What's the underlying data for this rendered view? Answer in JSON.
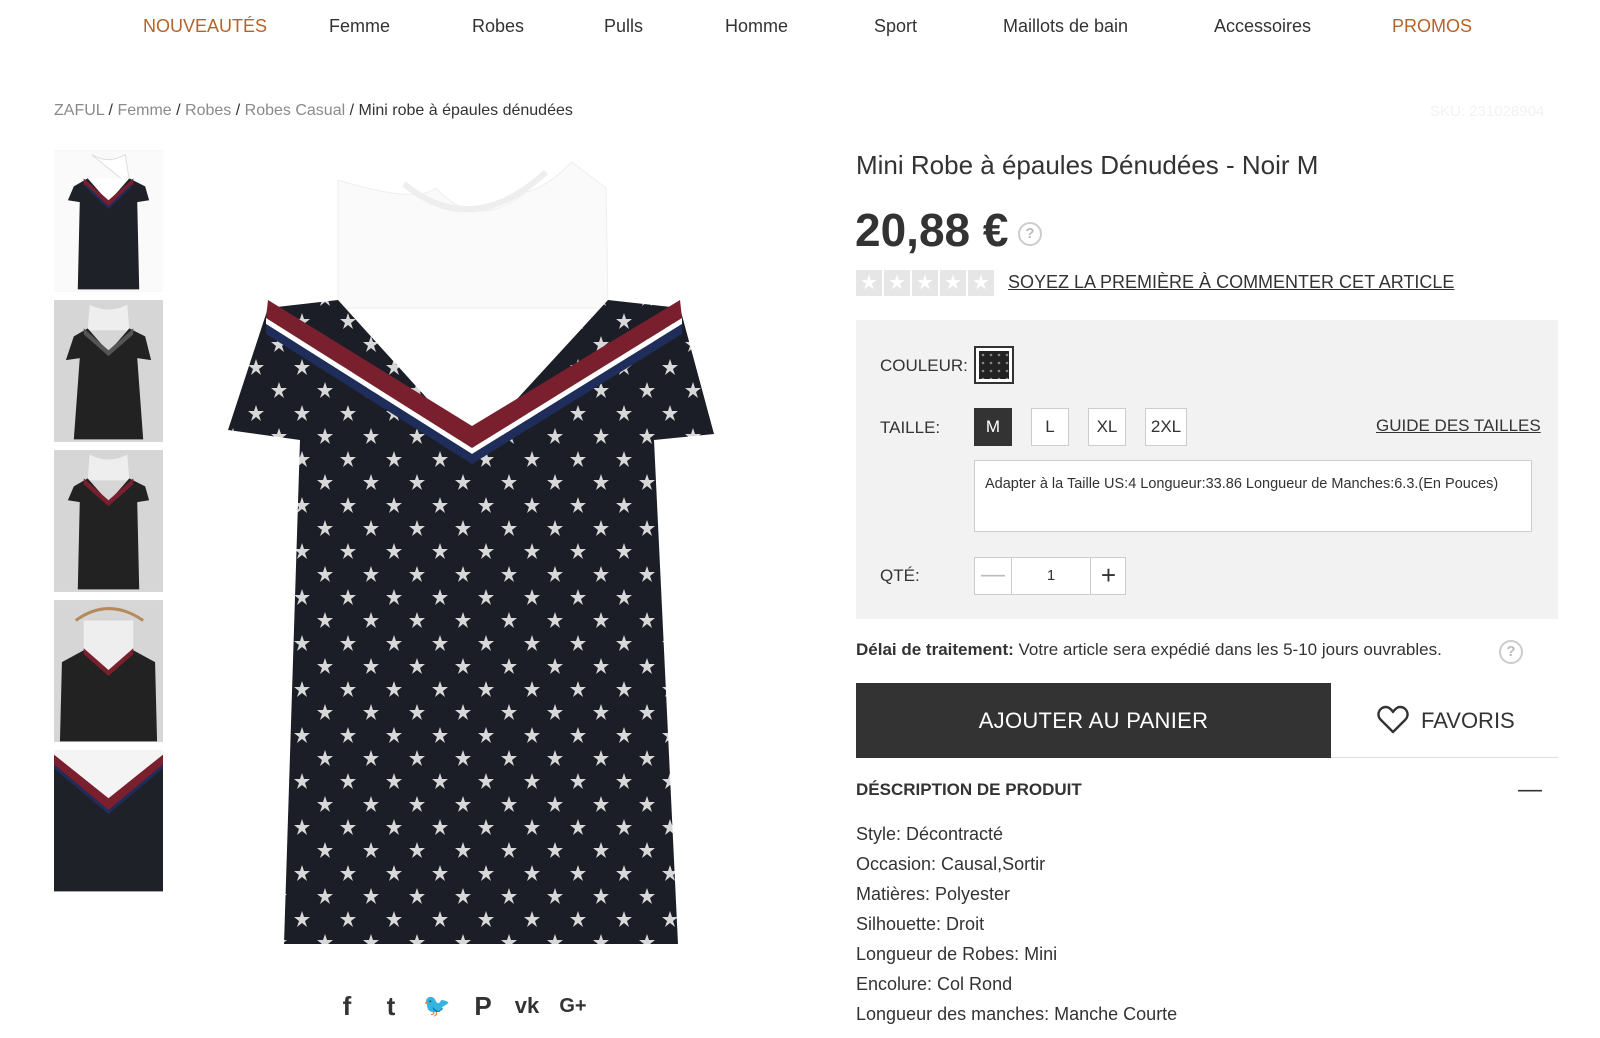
{
  "nav": {
    "items": [
      {
        "label": "NOUVEAUTÉS",
        "accent": true
      },
      {
        "label": "Femme",
        "accent": false
      },
      {
        "label": "Robes",
        "accent": false
      },
      {
        "label": "Pulls",
        "accent": false
      },
      {
        "label": "Homme",
        "accent": false
      },
      {
        "label": "Sport",
        "accent": false
      },
      {
        "label": "Maillots de bain",
        "accent": false
      },
      {
        "label": "Accessoires",
        "accent": false
      },
      {
        "label": "PROMOS",
        "accent": true
      }
    ],
    "accent_color": "#b4632b"
  },
  "breadcrumb": {
    "items": [
      "ZAFUL",
      "Femme",
      "Robes",
      "Robes Casual"
    ],
    "separator": "/",
    "current": "Mini robe à épaules dénudées"
  },
  "sku": "SKU: 231028904",
  "product": {
    "title": "Mini Robe à épaules Dénudées - Noir M",
    "price": "20,88 €",
    "price_help_icon": "?",
    "rating_stars": 5,
    "rating_value": 0,
    "review_link": "SOYEZ LA PREMIÈRE À COMMENTER CET ARTICLE"
  },
  "options": {
    "color_label": "COULEUR:",
    "size_label": "TAILLE:",
    "sizes": [
      "M",
      "L",
      "XL",
      "2XL"
    ],
    "selected_size": "M",
    "size_guide": "GUIDE DES TAILLES",
    "size_info": "Adapter à la Taille US:4   Longueur:33.86   Longueur de Manches:6.3.(En Pouces)",
    "qty_label": "QTÉ:",
    "qty_value": "1",
    "qty_minus": "—",
    "qty_plus": "+"
  },
  "processing": {
    "label": "Délai de traitement:",
    "text": " Votre article sera expédié dans les 5-10 jours ouvrables.",
    "help_icon": "?"
  },
  "actions": {
    "add_to_cart": "AJOUTER AU PANIER",
    "favoris": "FAVORIS"
  },
  "description": {
    "header": "DÉSCRIPTION DE PRODUIT",
    "toggle": "—",
    "rows": [
      "Style: Décontracté",
      "Occasion: Causal,Sortir",
      "Matières: Polyester",
      "Silhouette: Droit",
      "Longueur de Robes: Mini",
      "Encolure: Col Rond",
      "Longueur des manches: Manche Courte"
    ]
  },
  "share": {
    "icons": [
      {
        "name": "facebook-icon",
        "glyph": "f"
      },
      {
        "name": "tumblr-icon",
        "glyph": "t"
      },
      {
        "name": "twitter-icon",
        "glyph": "🐦"
      },
      {
        "name": "pinterest-icon",
        "glyph": "P"
      },
      {
        "name": "vk-icon",
        "glyph": "vk"
      },
      {
        "name": "googleplus-icon",
        "glyph": "G+"
      }
    ]
  },
  "thumbnails": [
    {
      "name": "thumb-front",
      "selected": true
    },
    {
      "name": "thumb-model-front",
      "selected": false
    },
    {
      "name": "thumb-model-side",
      "selected": false
    },
    {
      "name": "thumb-hanger",
      "selected": false
    },
    {
      "name": "thumb-detail",
      "selected": false
    }
  ]
}
